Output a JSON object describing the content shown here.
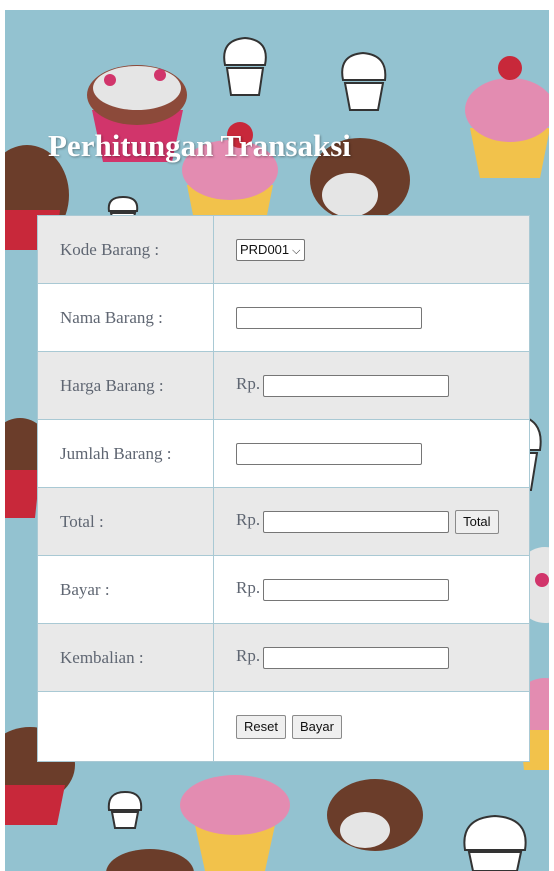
{
  "page": {
    "title": "Perhitungan Transaksi",
    "background_color": "#93c2d0",
    "cupcake_colors": [
      "#d1356b",
      "#e38cb1",
      "#f2c24b",
      "#8c2a35",
      "#6b3d2a",
      "#ffffff"
    ]
  },
  "form": {
    "kode_barang": {
      "label": "Kode Barang :",
      "selected": "PRD001"
    },
    "nama_barang": {
      "label": "Nama Barang :",
      "value": ""
    },
    "harga_barang": {
      "label": "Harga Barang :",
      "prefix": "Rp.",
      "value": ""
    },
    "jumlah_barang": {
      "label": "Jumlah Barang :",
      "value": ""
    },
    "total": {
      "label": "Total :",
      "prefix": "Rp.",
      "value": "",
      "button": "Total"
    },
    "bayar": {
      "label": "Bayar :",
      "prefix": "Rp.",
      "value": ""
    },
    "kembalian": {
      "label": "Kembalian :",
      "prefix": "Rp.",
      "value": ""
    },
    "actions": {
      "reset": "Reset",
      "bayar": "Bayar"
    }
  }
}
